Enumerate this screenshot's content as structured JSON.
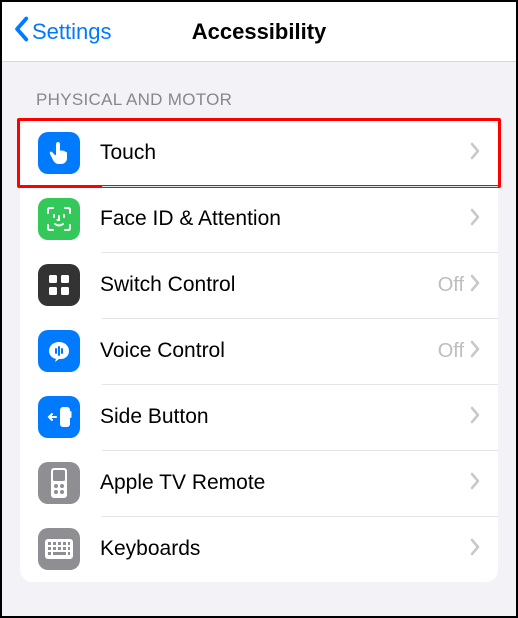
{
  "header": {
    "back_label": "Settings",
    "title": "Accessibility"
  },
  "section": {
    "title": "PHYSICAL AND MOTOR"
  },
  "rows": [
    {
      "label": "Touch",
      "value": "",
      "highlighted": true
    },
    {
      "label": "Face ID & Attention",
      "value": ""
    },
    {
      "label": "Switch Control",
      "value": "Off"
    },
    {
      "label": "Voice Control",
      "value": "Off"
    },
    {
      "label": "Side Button",
      "value": ""
    },
    {
      "label": "Apple TV Remote",
      "value": ""
    },
    {
      "label": "Keyboards",
      "value": ""
    }
  ]
}
